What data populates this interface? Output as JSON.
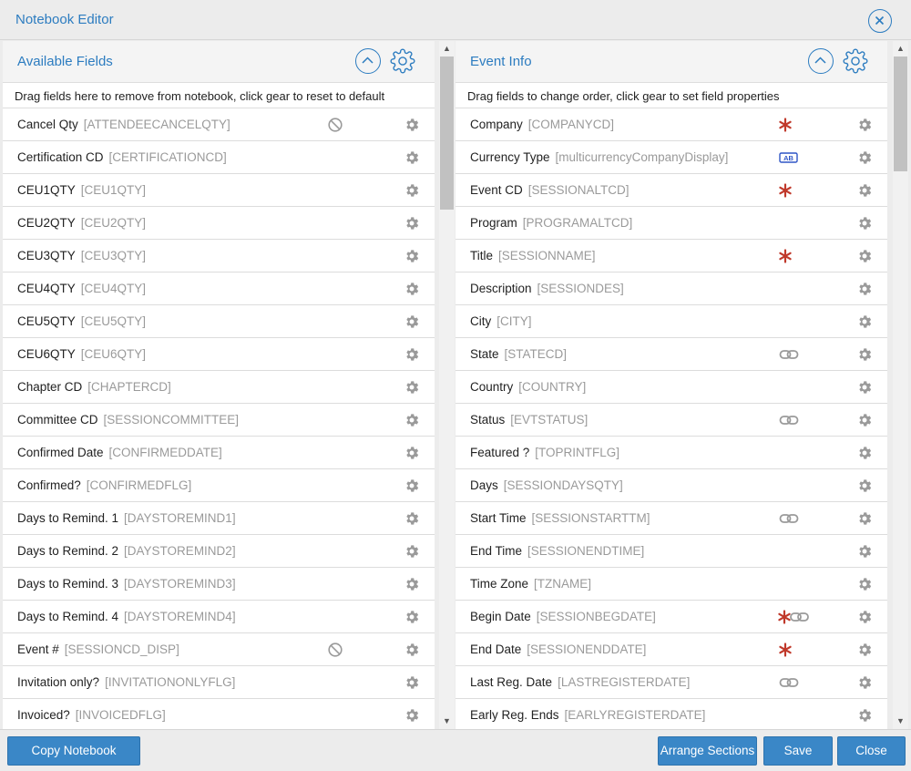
{
  "window": {
    "title": "Notebook Editor"
  },
  "left_panel": {
    "title": "Available Fields",
    "description": "Drag fields here to remove from notebook, click gear to reset to default",
    "rows": [
      {
        "label": "Cancel Qty",
        "code": "[ATTENDEECANCELQTY]",
        "flag": "blocked-icon"
      },
      {
        "label": "Certification CD",
        "code": "[CERTIFICATIONCD]"
      },
      {
        "label": "CEU1QTY",
        "code": "[CEU1QTY]"
      },
      {
        "label": "CEU2QTY",
        "code": "[CEU2QTY]"
      },
      {
        "label": "CEU3QTY",
        "code": "[CEU3QTY]"
      },
      {
        "label": "CEU4QTY",
        "code": "[CEU4QTY]"
      },
      {
        "label": "CEU5QTY",
        "code": "[CEU5QTY]"
      },
      {
        "label": "CEU6QTY",
        "code": "[CEU6QTY]"
      },
      {
        "label": "Chapter CD",
        "code": "[CHAPTERCD]"
      },
      {
        "label": "Committee CD",
        "code": "[SESSIONCOMMITTEE]"
      },
      {
        "label": "Confirmed Date",
        "code": "[CONFIRMEDDATE]"
      },
      {
        "label": "Confirmed?",
        "code": "[CONFIRMEDFLG]"
      },
      {
        "label": "Days to Remind. 1",
        "code": "[DAYSTOREMIND1]"
      },
      {
        "label": "Days to Remind. 2",
        "code": "[DAYSTOREMIND2]"
      },
      {
        "label": "Days to Remind. 3",
        "code": "[DAYSTOREMIND3]"
      },
      {
        "label": "Days to Remind. 4",
        "code": "[DAYSTOREMIND4]"
      },
      {
        "label": "Event #",
        "code": "[SESSIONCD_DISP]",
        "flag": "blocked-icon"
      },
      {
        "label": "Invitation only?",
        "code": "[INVITATIONONLYFLG]"
      },
      {
        "label": "Invoiced?",
        "code": "[INVOICEDFLG]"
      }
    ]
  },
  "right_panel": {
    "title": "Event Info",
    "description": "Drag fields to change order, click gear to set field properties",
    "rows": [
      {
        "label": "Company",
        "code": "[COMPANYCD]",
        "flag": "required-icon"
      },
      {
        "label": "Currency Type",
        "code": "[multicurrencyCompanyDisplay]",
        "flag": "ab-badge-icon"
      },
      {
        "label": "Event CD",
        "code": "[SESSIONALTCD]",
        "flag": "required-icon"
      },
      {
        "label": "Program",
        "code": "[PROGRAMALTCD]"
      },
      {
        "label": "Title",
        "code": "[SESSIONNAME]",
        "flag": "required-icon"
      },
      {
        "label": "Description",
        "code": "[SESSIONDES]"
      },
      {
        "label": "City",
        "code": "[CITY]"
      },
      {
        "label": "State",
        "code": "[STATECD]",
        "flag": "link-icon"
      },
      {
        "label": "Country",
        "code": "[COUNTRY]"
      },
      {
        "label": "Status",
        "code": "[EVTSTATUS]",
        "flag": "link-icon"
      },
      {
        "label": "Featured ?",
        "code": "[TOPRINTFLG]"
      },
      {
        "label": "Days",
        "code": "[SESSIONDAYSQTY]"
      },
      {
        "label": "Start Time",
        "code": "[SESSIONSTARTTM]",
        "flag": "link-icon"
      },
      {
        "label": "End Time",
        "code": "[SESSIONENDTIME]"
      },
      {
        "label": "Time Zone",
        "code": "[TZNAME]"
      },
      {
        "label": "Begin Date",
        "code": "[SESSIONBEGDATE]",
        "flag": "required-link-icon"
      },
      {
        "label": "End Date",
        "code": "[SESSIONENDDATE]",
        "flag": "required-icon"
      },
      {
        "label": "Last Reg. Date",
        "code": "[LASTREGISTERDATE]",
        "flag": "link-icon"
      },
      {
        "label": "Early Reg. Ends",
        "code": "[EARLYREGISTERDATE]"
      }
    ]
  },
  "ab_badge": "AB",
  "footer": {
    "copy_label": "Copy Notebook Settings",
    "arrange_label": "Arrange Sections",
    "save_label": "Save",
    "close_label": "Close"
  },
  "colors": {
    "accent": "#2c7cc0",
    "button": "#3a87c7",
    "required": "#c0392b",
    "icon_gray": "#9a9a9a"
  }
}
